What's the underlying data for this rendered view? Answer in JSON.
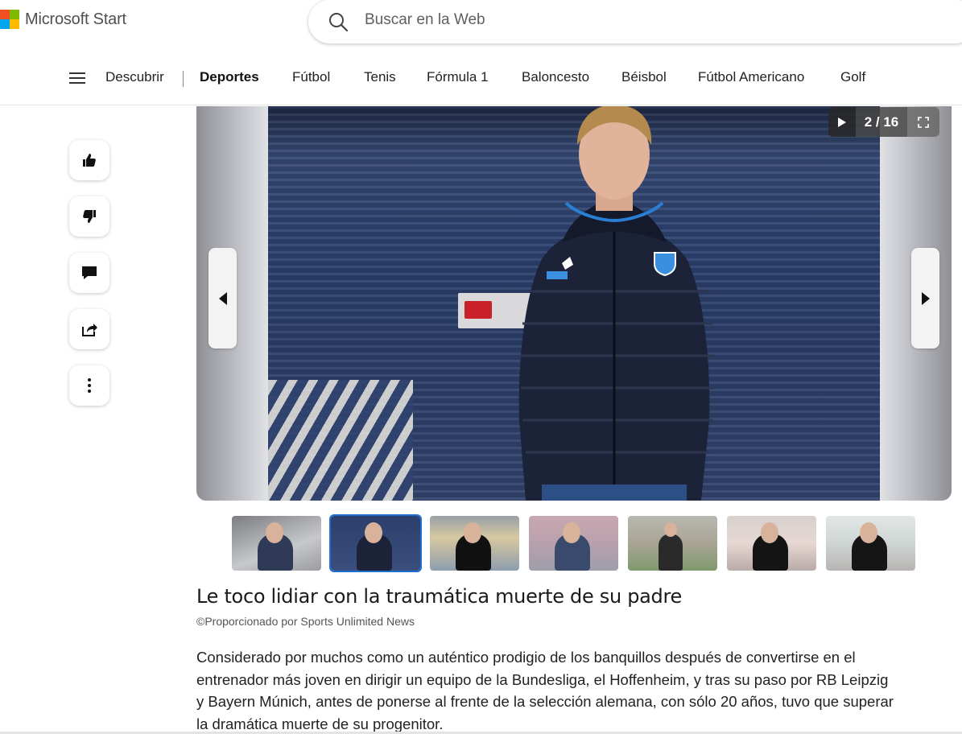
{
  "header": {
    "brand": "Microsoft Start",
    "logo_colors": [
      "#f25022",
      "#7fba00",
      "#00a4ef",
      "#ffb900"
    ],
    "search_placeholder": "Buscar en la Web"
  },
  "nav": {
    "items": [
      {
        "label": "Descubrir",
        "active": false
      },
      {
        "label": "Deportes",
        "active": true
      },
      {
        "label": "Fútbol",
        "active": false
      },
      {
        "label": "Tenis",
        "active": false
      },
      {
        "label": "Fórmula 1",
        "active": false
      },
      {
        "label": "Baloncesto",
        "active": false
      },
      {
        "label": "Béisbol",
        "active": false
      },
      {
        "label": "Fútbol Americano",
        "active": false
      },
      {
        "label": "Golf",
        "active": false
      }
    ]
  },
  "side_actions": [
    "thumbs-up-icon",
    "thumbs-down-icon",
    "comment-icon",
    "share-icon",
    "more-options-icon"
  ],
  "gallery": {
    "counter": "2 / 16",
    "current_slide": 2,
    "total_slides": 16,
    "thumbnail_count": 7,
    "selected_thumbnail": 2
  },
  "article": {
    "title": "Le toco lidiar con la traumática muerte de su padre",
    "source": "©Proporcionado por Sports Unlimited News",
    "body": "Considerado por muchos como un auténtico prodigio de los banquillos después de convertirse en el entrenador más joven en dirigir un equipo de la Bundesliga, el Hoffenheim, y tras su paso por RB Leipzig y Bayern Múnich, antes de ponerse al frente de la selección alemana, con sólo 20 años, tuvo que superar la dramática muerte de su progenitor."
  }
}
